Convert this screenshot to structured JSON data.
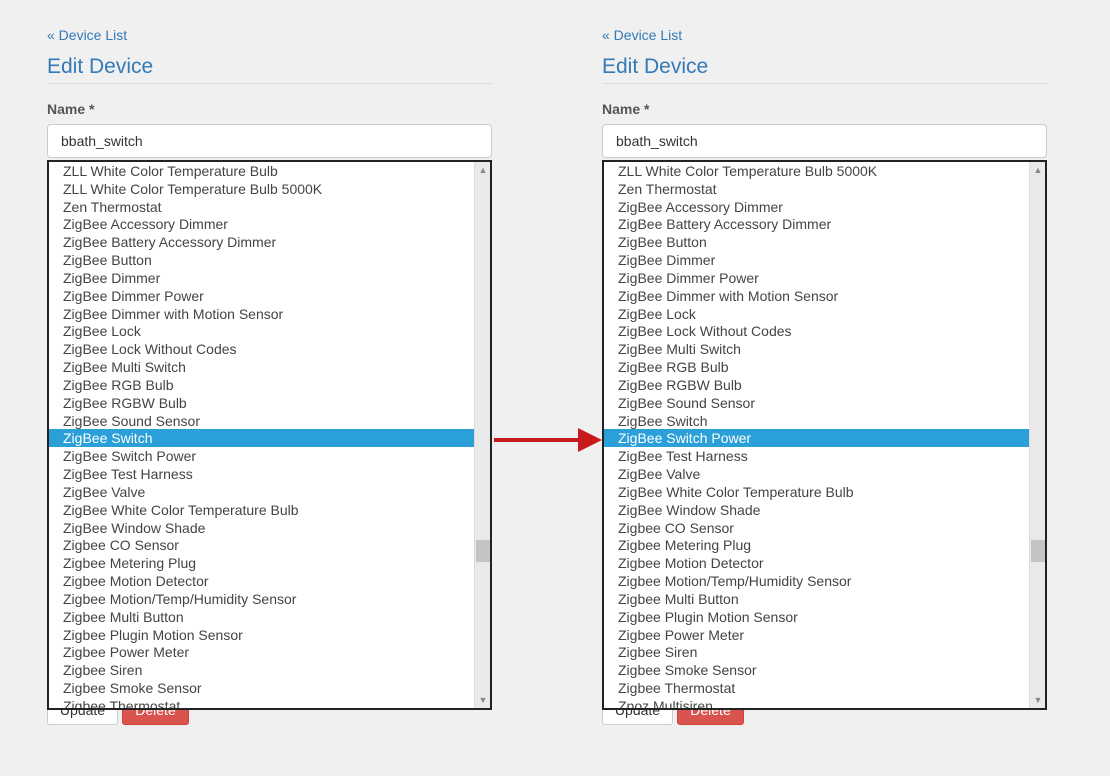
{
  "left_panel": {
    "back_link": "« Device List",
    "title": "Edit Device",
    "name_label": "Name *",
    "name_value": "bbath_switch",
    "update_label": "Update",
    "delete_label": "Delete",
    "options": [
      "ZLL White Color Temperature Bulb",
      "ZLL White Color Temperature Bulb 5000K",
      "Zen Thermostat",
      "ZigBee Accessory Dimmer",
      "ZigBee Battery Accessory Dimmer",
      "ZigBee Button",
      "ZigBee Dimmer",
      "ZigBee Dimmer Power",
      "ZigBee Dimmer with Motion Sensor",
      "ZigBee Lock",
      "ZigBee Lock Without Codes",
      "ZigBee Multi Switch",
      "ZigBee RGB Bulb",
      "ZigBee RGBW Bulb",
      "ZigBee Sound Sensor",
      "ZigBee Switch",
      "ZigBee Switch Power",
      "ZigBee Test Harness",
      "ZigBee Valve",
      "ZigBee White Color Temperature Bulb",
      "ZigBee Window Shade",
      "Zigbee CO Sensor",
      "Zigbee Metering Plug",
      "Zigbee Motion Detector",
      "Zigbee Motion/Temp/Humidity Sensor",
      "Zigbee Multi Button",
      "Zigbee Plugin Motion Sensor",
      "Zigbee Power Meter",
      "Zigbee Siren",
      "Zigbee Smoke Sensor",
      "Zigbee Thermostat"
    ],
    "selected_index": 15
  },
  "right_panel": {
    "back_link": "« Device List",
    "title": "Edit Device",
    "name_label": "Name *",
    "name_value": "bbath_switch",
    "update_label": "Update",
    "delete_label": "Delete",
    "options": [
      "ZLL White Color Temperature Bulb 5000K",
      "Zen Thermostat",
      "ZigBee Accessory Dimmer",
      "ZigBee Battery Accessory Dimmer",
      "ZigBee Button",
      "ZigBee Dimmer",
      "ZigBee Dimmer Power",
      "ZigBee Dimmer with Motion Sensor",
      "ZigBee Lock",
      "ZigBee Lock Without Codes",
      "ZigBee Multi Switch",
      "ZigBee RGB Bulb",
      "ZigBee RGBW Bulb",
      "ZigBee Sound Sensor",
      "ZigBee Switch",
      "ZigBee Switch Power",
      "ZigBee Test Harness",
      "ZigBee Valve",
      "ZigBee White Color Temperature Bulb",
      "ZigBee Window Shade",
      "Zigbee CO Sensor",
      "Zigbee Metering Plug",
      "Zigbee Motion Detector",
      "Zigbee Motion/Temp/Humidity Sensor",
      "Zigbee Multi Button",
      "Zigbee Plugin Motion Sensor",
      "Zigbee Power Meter",
      "Zigbee Siren",
      "Zigbee Smoke Sensor",
      "Zigbee Thermostat",
      "Zpoz Multisiren"
    ],
    "selected_index": 15
  },
  "icons": {
    "scroll_up": "scroll-up-arrow-icon",
    "scroll_down": "scroll-down-arrow-icon",
    "transition": "right-arrow-icon"
  },
  "colors": {
    "link": "#337ab7",
    "selected_bg": "#2a9fd8",
    "delete_button": "#d9534f",
    "arrow": "#c8191b"
  }
}
